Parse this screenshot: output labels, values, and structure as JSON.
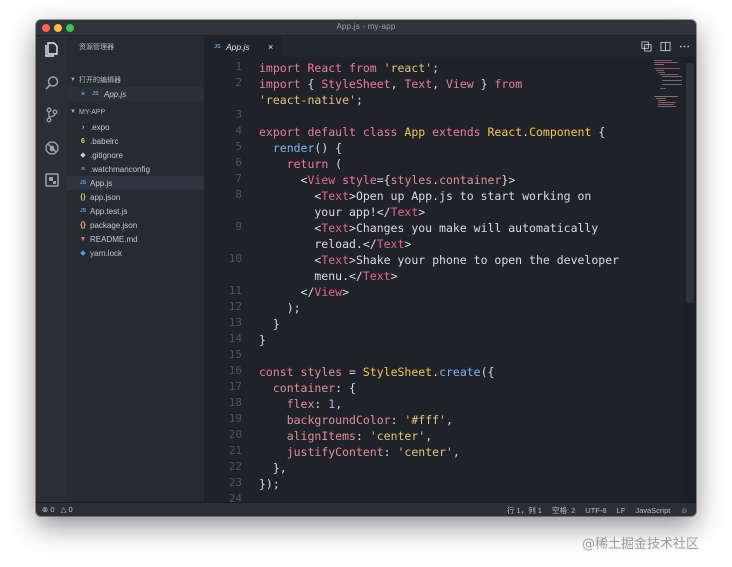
{
  "window": {
    "title": "App.js - my-app"
  },
  "activity": [
    "explorer-icon",
    "search-icon",
    "source-control-icon",
    "debug-icon",
    "extensions-icon"
  ],
  "sidebar": {
    "title": "资源管理器",
    "open_editors": {
      "header": "打开的编辑器",
      "items": [
        {
          "close": "×",
          "type": "JS",
          "label": "App.js"
        }
      ]
    },
    "project": {
      "header": "MY-APP",
      "items": [
        {
          "icon": "›",
          "icon_color": "#c5cbd3",
          "label": ".expo"
        },
        {
          "icon": "6",
          "icon_color": "#e3c57c",
          "label": ".babelrc"
        },
        {
          "icon": "◆",
          "icon_color": "#c5cbd3",
          "label": ".gitignore"
        },
        {
          "icon": "≡",
          "icon_color": "#a6adb8",
          "label": ".watchmanconfig"
        },
        {
          "icon": "JS",
          "icon_color": "#5f9fd8",
          "label": "App.js"
        },
        {
          "icon": "{}",
          "icon_color": "#e3c57c",
          "label": "app.json"
        },
        {
          "icon": "JS",
          "icon_color": "#5f9fd8",
          "label": "App.test.js"
        },
        {
          "icon": "{}",
          "icon_color": "#e3c57c",
          "label": "package.json"
        },
        {
          "icon": "▼",
          "icon_color": "#e5678a",
          "label": "README.md"
        },
        {
          "icon": "◆",
          "icon_color": "#5f9fd8",
          "label": "yarn.lock"
        }
      ]
    }
  },
  "tab": {
    "type": "JS",
    "label": "App.js",
    "close": "×"
  },
  "editor": {
    "line_numbers": [
      "1",
      "2",
      "",
      "3",
      "4",
      "5",
      "6",
      "7",
      "8",
      "",
      "9",
      "",
      "10",
      "",
      "11",
      "12",
      "13",
      "14",
      "15",
      "16",
      "17",
      "18",
      "19",
      "20",
      "21",
      "22",
      "23",
      "24"
    ],
    "lines": [
      [
        [
          "k",
          "import "
        ],
        [
          "k",
          "React "
        ],
        [
          "k",
          "from "
        ],
        [
          "s",
          "'react'"
        ],
        [
          "w",
          ";"
        ]
      ],
      [
        [
          "k",
          "import "
        ],
        [
          "w",
          "{ "
        ],
        [
          "k",
          "StyleSheet"
        ],
        [
          "w",
          ", "
        ],
        [
          "k",
          "Text"
        ],
        [
          "w",
          ", "
        ],
        [
          "k",
          "View "
        ],
        [
          "w",
          "} "
        ],
        [
          "k",
          "from"
        ]
      ],
      [
        [
          "s",
          "'react-native'"
        ],
        [
          "w",
          ";"
        ]
      ],
      [],
      [
        [
          "k",
          "export default class "
        ],
        [
          "c",
          "App "
        ],
        [
          "k",
          "extends "
        ],
        [
          "c",
          "React"
        ],
        [
          "w",
          "."
        ],
        [
          "c",
          "Component "
        ],
        [
          "w",
          "{"
        ]
      ],
      [
        [
          "w",
          "  "
        ],
        [
          "f",
          "render"
        ],
        [
          "w",
          "() {"
        ]
      ],
      [
        [
          "w",
          "    "
        ],
        [
          "k",
          "return "
        ],
        [
          "w",
          "("
        ]
      ],
      [
        [
          "w",
          "      <"
        ],
        [
          "t",
          "View "
        ],
        [
          "a",
          "style"
        ],
        [
          "w",
          "="
        ],
        [
          "w",
          "{"
        ],
        [
          "p",
          "styles"
        ],
        [
          "w",
          "."
        ],
        [
          "p",
          "container"
        ],
        [
          "w",
          "}"
        ],
        [
          "w",
          ">"
        ]
      ],
      [
        [
          "w",
          "        <"
        ],
        [
          "t",
          "Text"
        ],
        [
          "w",
          ">Open up App.js to start working on"
        ]
      ],
      [
        [
          "w",
          "        your app!</"
        ],
        [
          "t",
          "Text"
        ],
        [
          "w",
          ">"
        ]
      ],
      [
        [
          "w",
          "        <"
        ],
        [
          "t",
          "Text"
        ],
        [
          "w",
          ">Changes you make will automatically"
        ]
      ],
      [
        [
          "w",
          "        reload.</"
        ],
        [
          "t",
          "Text"
        ],
        [
          "w",
          ">"
        ]
      ],
      [
        [
          "w",
          "        <"
        ],
        [
          "t",
          "Text"
        ],
        [
          "w",
          ">Shake your phone to open the developer"
        ]
      ],
      [
        [
          "w",
          "        menu.</"
        ],
        [
          "t",
          "Text"
        ],
        [
          "w",
          ">"
        ]
      ],
      [
        [
          "w",
          "      </"
        ],
        [
          "t",
          "View"
        ],
        [
          "w",
          ">"
        ]
      ],
      [
        [
          "w",
          "    );"
        ]
      ],
      [
        [
          "w",
          "  }"
        ]
      ],
      [
        [
          "w",
          "}"
        ]
      ],
      [],
      [
        [
          "k",
          "const "
        ],
        [
          "p",
          "styles "
        ],
        [
          "w",
          "= "
        ],
        [
          "c",
          "StyleSheet"
        ],
        [
          "w",
          "."
        ],
        [
          "f",
          "create"
        ],
        [
          "w",
          "({"
        ]
      ],
      [
        [
          "w",
          "  "
        ],
        [
          "p",
          "container"
        ],
        [
          "w",
          ": {"
        ]
      ],
      [
        [
          "w",
          "    "
        ],
        [
          "p",
          "flex"
        ],
        [
          "w",
          ": "
        ],
        [
          "n",
          "1"
        ],
        [
          "w",
          ","
        ]
      ],
      [
        [
          "w",
          "    "
        ],
        [
          "p",
          "backgroundColor"
        ],
        [
          "w",
          ": "
        ],
        [
          "s",
          "'#fff'"
        ],
        [
          "w",
          ","
        ]
      ],
      [
        [
          "w",
          "    "
        ],
        [
          "p",
          "alignItems"
        ],
        [
          "w",
          ": "
        ],
        [
          "s",
          "'center'"
        ],
        [
          "w",
          ","
        ]
      ],
      [
        [
          "w",
          "    "
        ],
        [
          "p",
          "justifyContent"
        ],
        [
          "w",
          ": "
        ],
        [
          "s",
          "'center'"
        ],
        [
          "w",
          ","
        ]
      ],
      [
        [
          "w",
          "  },"
        ]
      ],
      [
        [
          "w",
          "});"
        ]
      ],
      []
    ]
  },
  "status": {
    "errors": "0",
    "warnings": "0",
    "position": "行 1，列 1",
    "indent": "空格: 2",
    "encoding": "UTF-8",
    "eol": "LF",
    "language": "JavaScript",
    "feedback": "☺"
  },
  "watermark": "@稀土掘金技术社区",
  "colors": {
    "window_bg": "#22262e",
    "editor_bg": "#1f2228",
    "keyword": "#f27b9a",
    "string": "#e3c57c",
    "class": "#f6c94b",
    "function": "#7db6ee"
  }
}
